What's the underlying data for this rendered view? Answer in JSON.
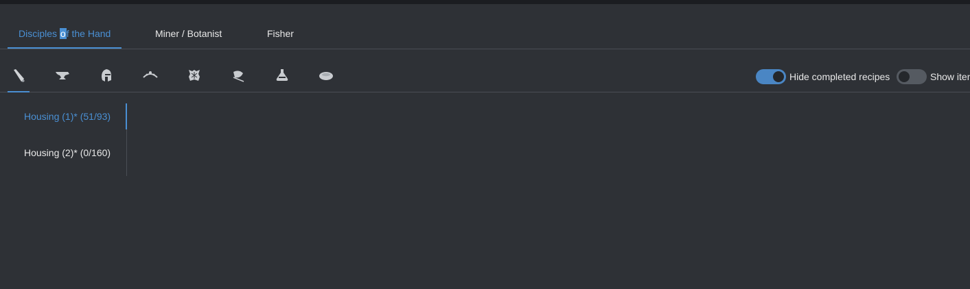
{
  "class_tabs": [
    {
      "label_before": "Disciples ",
      "label_selected": "o",
      "label_after": "f the Hand",
      "active": true
    },
    {
      "label": "Miner / Botanist",
      "active": false
    },
    {
      "label": "Fisher",
      "active": false
    }
  ],
  "job_icons": [
    {
      "icon": "carpenter-saw-icon",
      "active": true
    },
    {
      "icon": "blacksmith-anvil-icon",
      "active": false
    },
    {
      "icon": "armorer-helmet-icon",
      "active": false
    },
    {
      "icon": "goldsmith-circlet-icon",
      "active": false
    },
    {
      "icon": "leatherworker-hide-icon",
      "active": false
    },
    {
      "icon": "weaver-needle-icon",
      "active": false
    },
    {
      "icon": "alchemist-flask-icon",
      "active": false
    },
    {
      "icon": "culinarian-dish-icon",
      "active": false
    }
  ],
  "toggles": {
    "hide_completed": {
      "label": "Hide completed recipes",
      "on": true
    },
    "show_items": {
      "label": "Show iten",
      "on": false
    }
  },
  "recipe_groups": [
    {
      "label": "Housing (1)* (51/93)",
      "active": true
    },
    {
      "label": "Housing (2)* (0/160)",
      "active": false
    }
  ],
  "colors": {
    "accent": "#4a90d4",
    "background": "#2e3136",
    "text": "#e8e8e8",
    "divider": "#4a4e55"
  }
}
